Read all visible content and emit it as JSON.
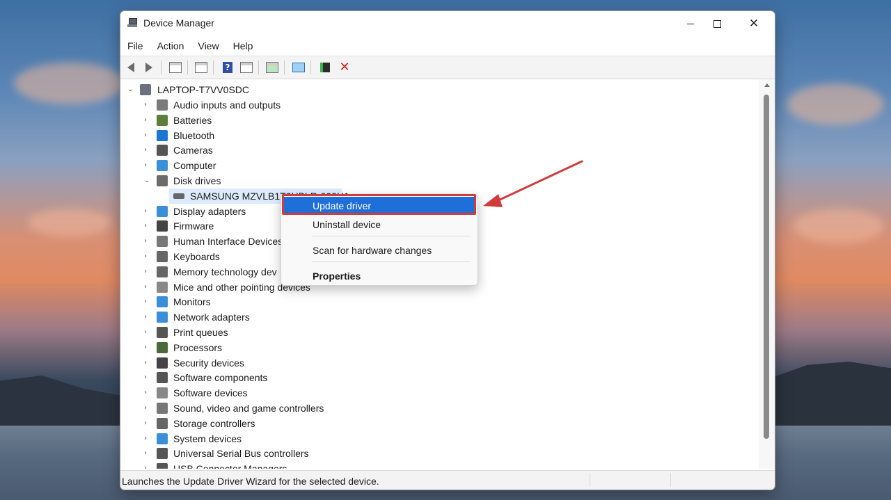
{
  "colors": {
    "accent": "#1f6fd8",
    "annotation": "#d13b3b",
    "selection": "#dcecfc"
  },
  "window": {
    "title": "Device Manager",
    "controls": {
      "minimize": "minimize-icon",
      "maximize": "maximize-icon",
      "close": "close-icon"
    }
  },
  "menu": [
    "File",
    "Action",
    "View",
    "Help"
  ],
  "toolbar": [
    "back-arrow-icon",
    "forward-arrow-icon",
    "show-hide-console-tree-icon",
    "properties-icon",
    "help-icon",
    "action-pane-icon",
    "scan-hardware-icon",
    "monitor-icon",
    "update-driver-icon",
    "uninstall-icon"
  ],
  "tree": {
    "root": "LAPTOP-T7VV0SDC",
    "categories": [
      {
        "label": "Audio inputs and outputs",
        "icon": "speaker-icon"
      },
      {
        "label": "Batteries",
        "icon": "battery-icon"
      },
      {
        "label": "Bluetooth",
        "icon": "bluetooth-icon"
      },
      {
        "label": "Cameras",
        "icon": "camera-icon"
      },
      {
        "label": "Computer",
        "icon": "computer-icon"
      },
      {
        "label": "Disk drives",
        "icon": "disk-drive-icon",
        "expanded": true
      },
      {
        "label": "Display adapters",
        "icon": "display-adapter-icon"
      },
      {
        "label": "Firmware",
        "icon": "firmware-icon"
      },
      {
        "label": "Human Interface Devices",
        "icon": "hid-icon"
      },
      {
        "label": "Keyboards",
        "icon": "keyboard-icon"
      },
      {
        "label": "Memory technology dev",
        "icon": "memory-icon"
      },
      {
        "label": "Mice and other pointing devices",
        "icon": "mouse-icon"
      },
      {
        "label": "Monitors",
        "icon": "monitor-icon"
      },
      {
        "label": "Network adapters",
        "icon": "network-icon"
      },
      {
        "label": "Print queues",
        "icon": "printer-icon"
      },
      {
        "label": "Processors",
        "icon": "processor-icon"
      },
      {
        "label": "Security devices",
        "icon": "security-icon"
      },
      {
        "label": "Software components",
        "icon": "software-component-icon"
      },
      {
        "label": "Software devices",
        "icon": "software-device-icon"
      },
      {
        "label": "Sound, video and game controllers",
        "icon": "sound-icon"
      },
      {
        "label": "Storage controllers",
        "icon": "storage-icon"
      },
      {
        "label": "System devices",
        "icon": "system-icon"
      },
      {
        "label": "Universal Serial Bus controllers",
        "icon": "usb-icon"
      },
      {
        "label": "USB Connector Managers",
        "icon": "usb-connector-icon"
      }
    ],
    "disk_child": "SAMSUNG MZVLB1T0HBLR-000H1"
  },
  "context_menu": {
    "items": [
      "Update driver",
      "Uninstall device",
      "Scan for hardware changes",
      "Properties"
    ],
    "highlighted": "Update driver"
  },
  "status": "Launches the Update Driver Wizard for the selected device."
}
